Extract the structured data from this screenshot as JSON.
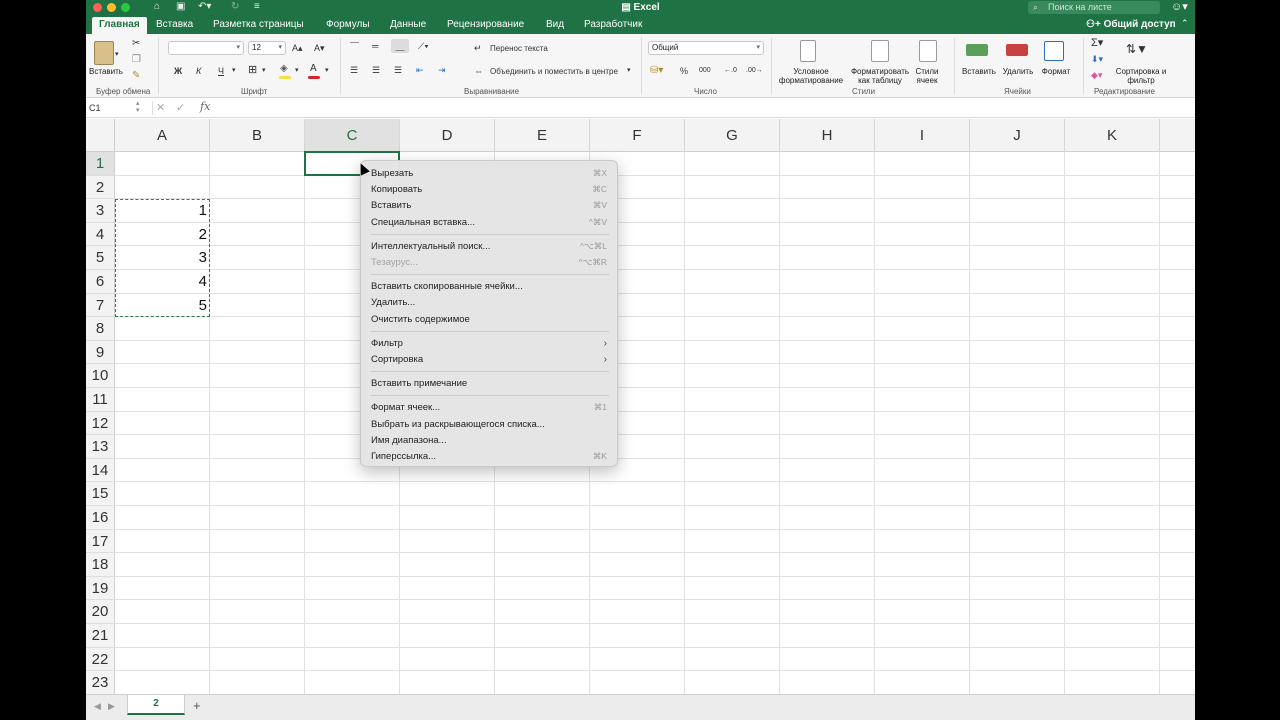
{
  "window": {
    "title": "Excel",
    "search_placeholder": "Поиск на листе",
    "share_label": "Общий доступ"
  },
  "tabs": [
    {
      "label": "Главная",
      "active": true
    },
    {
      "label": "Вставка"
    },
    {
      "label": "Разметка страницы"
    },
    {
      "label": "Формулы"
    },
    {
      "label": "Данные"
    },
    {
      "label": "Рецензирование"
    },
    {
      "label": "Вид"
    },
    {
      "label": "Разработчик"
    }
  ],
  "ribbon": {
    "clipboard": {
      "paste_label": "Вставить",
      "group_label": "Буфер обмена"
    },
    "font": {
      "name_value": "",
      "size_value": "12",
      "bold": "Ж",
      "italic": "К",
      "underline": "Ч",
      "group_label": "Шрифт"
    },
    "alignment": {
      "wrap_text": "Перенос текста",
      "merge_center": "Объединить и поместить в центре",
      "group_label": "Выравнивание"
    },
    "number": {
      "format_value": "Общий",
      "percent": "%",
      "thousands": "000",
      "group_label": "Число"
    },
    "styles": {
      "conditional": "Условное форматирование",
      "as_table": "Форматировать как таблицу",
      "cell_styles": "Стили ячеек",
      "group_label": "Стили"
    },
    "cells": {
      "insert": "Вставить",
      "delete": "Удалить",
      "format": "Формат",
      "group_label": "Ячейки"
    },
    "editing": {
      "sort_filter": "Сортировка и фильтр",
      "group_label": "Редактирование"
    }
  },
  "formula_bar": {
    "name_box": "C1",
    "fx": "fx",
    "value": ""
  },
  "grid": {
    "columns": [
      "A",
      "B",
      "C",
      "D",
      "E",
      "F",
      "G",
      "H",
      "I",
      "J",
      "K"
    ],
    "selected_column": "C",
    "rows": [
      "1",
      "2",
      "3",
      "4",
      "5",
      "6",
      "7",
      "8",
      "9",
      "10",
      "11",
      "12",
      "13",
      "14",
      "15",
      "16",
      "17",
      "18",
      "19",
      "20",
      "21",
      "22",
      "23"
    ],
    "selected_row": "1",
    "cells": [
      {
        "ref": "A3",
        "value": "1"
      },
      {
        "ref": "A4",
        "value": "2"
      },
      {
        "ref": "A5",
        "value": "3"
      },
      {
        "ref": "A6",
        "value": "4"
      },
      {
        "ref": "A7",
        "value": "5"
      }
    ],
    "active_cell": "C1",
    "copy_range": "A3:A7"
  },
  "sheets": [
    {
      "name": "2",
      "active": true
    }
  ],
  "context_menu": {
    "items": [
      {
        "label": "Вырезать",
        "shortcut": "⌘X"
      },
      {
        "label": "Копировать",
        "shortcut": "⌘C"
      },
      {
        "label": "Вставить",
        "shortcut": "⌘V"
      },
      {
        "label": "Специальная вставка...",
        "shortcut": "^⌘V"
      },
      {
        "label": "Интеллектуальный поиск...",
        "shortcut": "^⌥⌘L"
      },
      {
        "label": "Тезаурус...",
        "shortcut": "^⌥⌘R",
        "disabled": true
      },
      {
        "label": "Вставить скопированные ячейки..."
      },
      {
        "label": "Удалить..."
      },
      {
        "label": "Очистить содержимое"
      },
      {
        "label": "Фильтр",
        "submenu": true
      },
      {
        "label": "Сортировка",
        "submenu": true
      },
      {
        "label": "Вставить примечание"
      },
      {
        "label": "Формат ячеек...",
        "shortcut": "⌘1"
      },
      {
        "label": "Выбрать из раскрывающегося списка..."
      },
      {
        "label": "Имя диапазона..."
      },
      {
        "label": "Гиперссылка...",
        "shortcut": "⌘K"
      }
    ]
  },
  "colors": {
    "accent": "#1f7243",
    "copy_marquee": "#2b7e4d"
  }
}
